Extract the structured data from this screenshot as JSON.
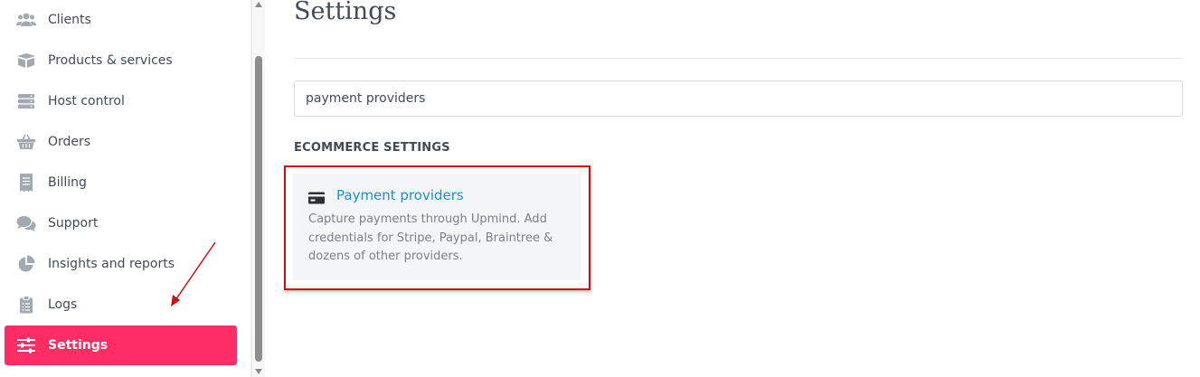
{
  "sidebar": {
    "items": [
      {
        "label": "Clients",
        "icon": "users-icon"
      },
      {
        "label": "Products & services",
        "icon": "box-icon"
      },
      {
        "label": "Host control",
        "icon": "server-icon"
      },
      {
        "label": "Orders",
        "icon": "basket-icon"
      },
      {
        "label": "Billing",
        "icon": "receipt-icon"
      },
      {
        "label": "Support",
        "icon": "chat-icon"
      },
      {
        "label": "Insights and reports",
        "icon": "pie-chart-icon"
      },
      {
        "label": "Logs",
        "icon": "clipboard-icon"
      },
      {
        "label": "Settings",
        "icon": "sliders-icon",
        "active": true
      }
    ]
  },
  "main": {
    "title": "Settings",
    "search": {
      "value": "payment providers"
    },
    "section_heading": "ECOMMERCE SETTINGS",
    "card": {
      "title": "Payment providers",
      "description": "Capture payments through Upmind. Add credentials for Stripe, Paypal, Braintree & dozens of other providers.",
      "icon": "credit-card-icon"
    }
  },
  "colors": {
    "accent": "#ff2d64",
    "link": "#1a8fd6",
    "highlight": "#d40b0b",
    "text": "#434a54"
  }
}
